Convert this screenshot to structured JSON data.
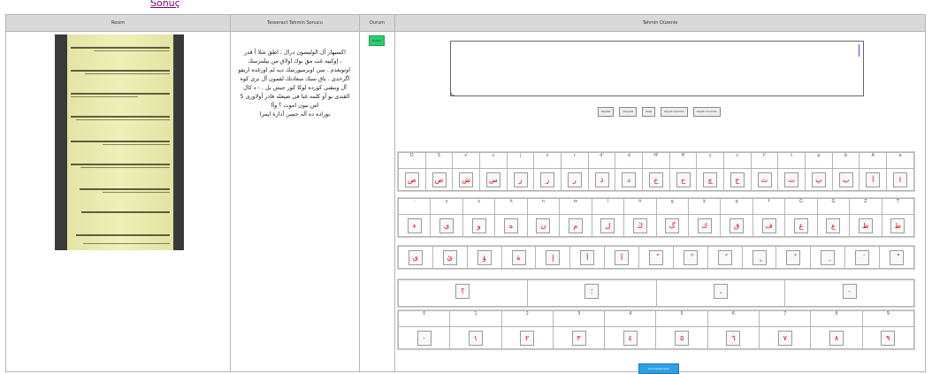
{
  "link": "Sonuç",
  "headers": [
    "Resim",
    "Tesseract Tahmin Sonucu",
    "Durum",
    "Tahmin Düzenle"
  ],
  "ocr_lines": [
    "اکسیهار أل الوليسون درال ، اطق شلا أ قدر",
    "، إوکيبه غب مق بوك اولاق من بيلمرسك",
    "اوتوبعدم . سن اوبرمیورسك دیه لم اورغده اریفو",
    "اگرخدی . باق سبك سعادتك لفمون أل نری کوه",
    "آل وبنفنی کورده لوکا کور جیش بل . - د کال",
    "القندی بو أو کلمه غبا فی ضیعله فادر أولاوری 5",
    "اس نبون اموت ؟ وأا",
    "بوراده ده أله حسن أدارة ایمرا"
  ],
  "durum": "Kontrol",
  "edit_buttons": [
    "Kaydet",
    "Kopyala",
    "Sesli",
    "Kayıtlı Cevirme",
    "Kayıtlı Cevirme"
  ],
  "row1": {
    "labels": [
      "D",
      "S",
      "s'",
      "s",
      "j",
      "z",
      "r",
      "d'",
      "d",
      "H'",
      "H",
      "ç",
      "c",
      "t'",
      "t",
      "p",
      "b",
      "A",
      "a"
    ],
    "keys": [
      "ص",
      "ص",
      "ش",
      "س",
      "ز",
      "ز",
      "ر",
      "ذ",
      "د",
      "خ",
      "ح",
      "چ",
      "ج",
      "ث",
      "ت",
      "پ",
      "ب",
      "آ",
      "ا"
    ]
  },
  "row2": {
    "labels": [
      "-",
      "y",
      "v",
      "h",
      "n",
      "m",
      "l",
      "ñ",
      "g",
      "k",
      "q",
      "f",
      "Ğ",
      "G",
      "Z",
      "T"
    ],
    "keys": [
      "ء",
      "ی",
      "و",
      "ه",
      "ن",
      "م",
      "ل",
      "ڭ",
      "گ",
      "ك",
      "ق",
      "ف",
      "غ",
      "ع",
      "ظ",
      "ط"
    ]
  },
  "row3": {
    "keys": [
      "ى",
      "ئ",
      "ؤ",
      "ة",
      "إ",
      "أ",
      "آ",
      "ّ",
      "ٌ",
      "ً",
      "ٍ",
      "ُ",
      "ِ",
      "َ",
      "ْ"
    ]
  },
  "row4": {
    "keys": [
      "؟",
      "؛",
      "،",
      "-"
    ]
  },
  "row5": {
    "labels": [
      "0",
      "1",
      "2",
      "3",
      "4",
      "5",
      "6",
      "7",
      "8",
      "9"
    ],
    "keys": [
      "٠",
      "١",
      "٢",
      "٣",
      "٤",
      "٥",
      "٦",
      "٧",
      "٨",
      "٩"
    ]
  },
  "submit": "Yeni Görsel Getir"
}
